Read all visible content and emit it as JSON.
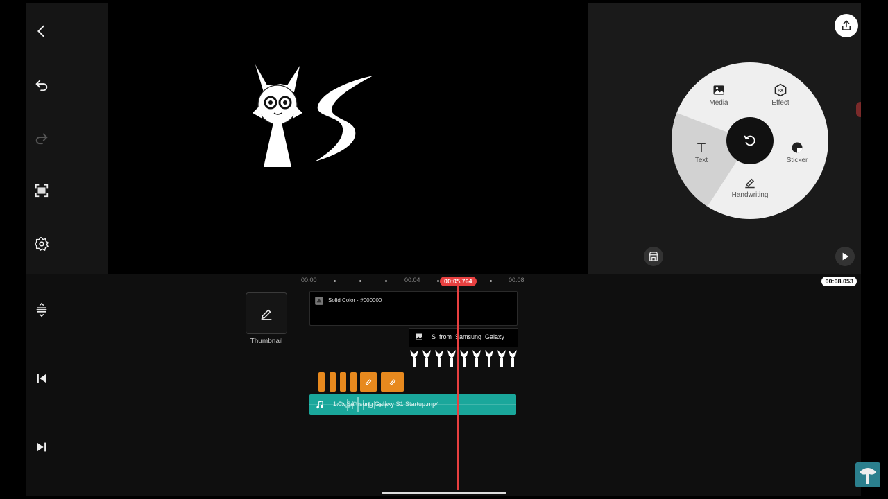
{
  "toolbar": {
    "back_icon": "chevron-left-icon",
    "undo_icon": "undo-icon",
    "redo_icon": "redo-icon",
    "screenshot_icon": "frame-capture-icon",
    "settings_icon": "gear-icon"
  },
  "right_panel": {
    "export_icon": "share-upload-icon",
    "store_icon": "store-icon",
    "play_icon": "play-icon",
    "total_duration": "00:08.053"
  },
  "wheel": {
    "media_label": "Media",
    "effect_label": "Effect",
    "effect_badge": "FX",
    "text_label": "Text",
    "sticker_label": "Sticker",
    "handwriting_label": "Handwriting",
    "center_icon": "rotate-back-icon"
  },
  "timeline": {
    "ticks": [
      "00:00",
      "00:04",
      "00:08"
    ],
    "playhead_time": "00:05.764",
    "thumbnail_label": "Thumbnail",
    "solid_color_label": "Solid Color · #000000",
    "image_layer_label": "S_from_Samsung_Galaxy_",
    "audio_label": "1.0x Samsung Galaxy S1 Startup.mp4",
    "left_controls": [
      "split-icon",
      "skip-to-start-icon",
      "skip-to-end-icon"
    ]
  },
  "colors": {
    "accent_red": "#e84040",
    "audio_teal": "#1aa79b",
    "effect_orange": "#e7891e"
  }
}
